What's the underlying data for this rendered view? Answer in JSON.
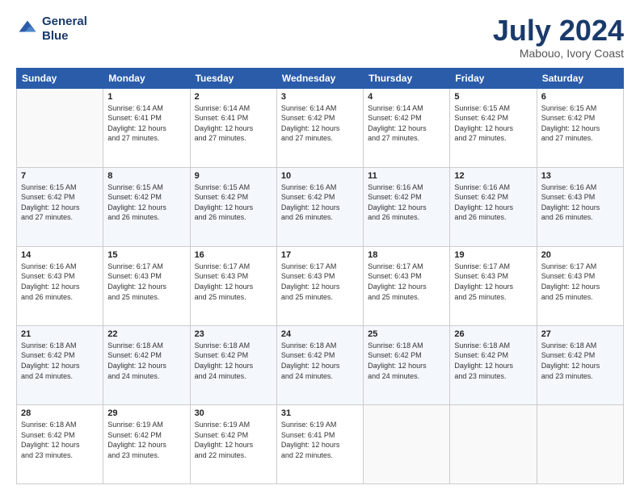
{
  "header": {
    "logo_line1": "General",
    "logo_line2": "Blue",
    "month": "July 2024",
    "location": "Mabouo, Ivory Coast"
  },
  "days_of_week": [
    "Sunday",
    "Monday",
    "Tuesday",
    "Wednesday",
    "Thursday",
    "Friday",
    "Saturday"
  ],
  "weeks": [
    [
      {
        "day": "",
        "info": ""
      },
      {
        "day": "1",
        "info": "Sunrise: 6:14 AM\nSunset: 6:41 PM\nDaylight: 12 hours\nand 27 minutes."
      },
      {
        "day": "2",
        "info": "Sunrise: 6:14 AM\nSunset: 6:41 PM\nDaylight: 12 hours\nand 27 minutes."
      },
      {
        "day": "3",
        "info": "Sunrise: 6:14 AM\nSunset: 6:42 PM\nDaylight: 12 hours\nand 27 minutes."
      },
      {
        "day": "4",
        "info": "Sunrise: 6:14 AM\nSunset: 6:42 PM\nDaylight: 12 hours\nand 27 minutes."
      },
      {
        "day": "5",
        "info": "Sunrise: 6:15 AM\nSunset: 6:42 PM\nDaylight: 12 hours\nand 27 minutes."
      },
      {
        "day": "6",
        "info": "Sunrise: 6:15 AM\nSunset: 6:42 PM\nDaylight: 12 hours\nand 27 minutes."
      }
    ],
    [
      {
        "day": "7",
        "info": ""
      },
      {
        "day": "8",
        "info": "Sunrise: 6:15 AM\nSunset: 6:42 PM\nDaylight: 12 hours\nand 26 minutes."
      },
      {
        "day": "9",
        "info": "Sunrise: 6:15 AM\nSunset: 6:42 PM\nDaylight: 12 hours\nand 26 minutes."
      },
      {
        "day": "10",
        "info": "Sunrise: 6:16 AM\nSunset: 6:42 PM\nDaylight: 12 hours\nand 26 minutes."
      },
      {
        "day": "11",
        "info": "Sunrise: 6:16 AM\nSunset: 6:42 PM\nDaylight: 12 hours\nand 26 minutes."
      },
      {
        "day": "12",
        "info": "Sunrise: 6:16 AM\nSunset: 6:42 PM\nDaylight: 12 hours\nand 26 minutes."
      },
      {
        "day": "13",
        "info": "Sunrise: 6:16 AM\nSunset: 6:43 PM\nDaylight: 12 hours\nand 26 minutes."
      }
    ],
    [
      {
        "day": "14",
        "info": ""
      },
      {
        "day": "15",
        "info": "Sunrise: 6:17 AM\nSunset: 6:43 PM\nDaylight: 12 hours\nand 25 minutes."
      },
      {
        "day": "16",
        "info": "Sunrise: 6:17 AM\nSunset: 6:43 PM\nDaylight: 12 hours\nand 25 minutes."
      },
      {
        "day": "17",
        "info": "Sunrise: 6:17 AM\nSunset: 6:43 PM\nDaylight: 12 hours\nand 25 minutes."
      },
      {
        "day": "18",
        "info": "Sunrise: 6:17 AM\nSunset: 6:43 PM\nDaylight: 12 hours\nand 25 minutes."
      },
      {
        "day": "19",
        "info": "Sunrise: 6:17 AM\nSunset: 6:43 PM\nDaylight: 12 hours\nand 25 minutes."
      },
      {
        "day": "20",
        "info": "Sunrise: 6:17 AM\nSunset: 6:43 PM\nDaylight: 12 hours\nand 25 minutes."
      }
    ],
    [
      {
        "day": "21",
        "info": ""
      },
      {
        "day": "22",
        "info": "Sunrise: 6:18 AM\nSunset: 6:42 PM\nDaylight: 12 hours\nand 24 minutes."
      },
      {
        "day": "23",
        "info": "Sunrise: 6:18 AM\nSunset: 6:42 PM\nDaylight: 12 hours\nand 24 minutes."
      },
      {
        "day": "24",
        "info": "Sunrise: 6:18 AM\nSunset: 6:42 PM\nDaylight: 12 hours\nand 24 minutes."
      },
      {
        "day": "25",
        "info": "Sunrise: 6:18 AM\nSunset: 6:42 PM\nDaylight: 12 hours\nand 24 minutes."
      },
      {
        "day": "26",
        "info": "Sunrise: 6:18 AM\nSunset: 6:42 PM\nDaylight: 12 hours\nand 23 minutes."
      },
      {
        "day": "27",
        "info": "Sunrise: 6:18 AM\nSunset: 6:42 PM\nDaylight: 12 hours\nand 23 minutes."
      }
    ],
    [
      {
        "day": "28",
        "info": "Sunrise: 6:18 AM\nSunset: 6:42 PM\nDaylight: 12 hours\nand 23 minutes."
      },
      {
        "day": "29",
        "info": "Sunrise: 6:19 AM\nSunset: 6:42 PM\nDaylight: 12 hours\nand 23 minutes."
      },
      {
        "day": "30",
        "info": "Sunrise: 6:19 AM\nSunset: 6:42 PM\nDaylight: 12 hours\nand 22 minutes."
      },
      {
        "day": "31",
        "info": "Sunrise: 6:19 AM\nSunset: 6:41 PM\nDaylight: 12 hours\nand 22 minutes."
      },
      {
        "day": "",
        "info": ""
      },
      {
        "day": "",
        "info": ""
      },
      {
        "day": "",
        "info": ""
      }
    ]
  ],
  "week7_day7": {
    "day": "7",
    "info": "Sunrise: 6:15 AM\nSunset: 6:42 PM\nDaylight: 12 hours\nand 27 minutes."
  },
  "week14_day": {
    "day": "14",
    "info": "Sunrise: 6:16 AM\nSunset: 6:43 PM\nDaylight: 12 hours\nand 26 minutes."
  },
  "week21_day": {
    "day": "21",
    "info": "Sunrise: 6:18 AM\nSunset: 6:42 PM\nDaylight: 12 hours\nand 24 minutes."
  }
}
